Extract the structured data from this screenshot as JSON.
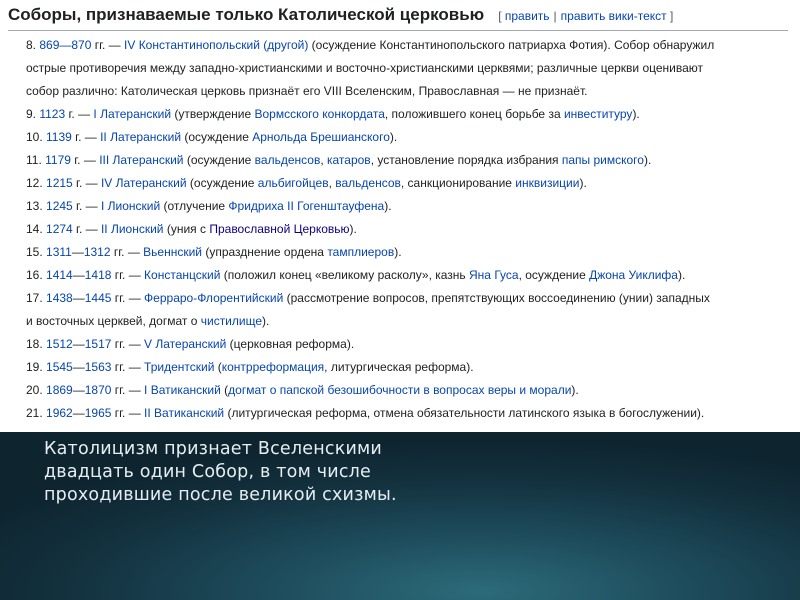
{
  "section": {
    "title": "Соборы, признаваемые только Католической церковью",
    "edit_open": "[",
    "edit_label": "править",
    "edit_sep": "|",
    "edit_source_label": "править вики-текст",
    "edit_close": "]"
  },
  "councils": [
    {
      "lines": [
        [
          {
            "t": "8. "
          },
          {
            "t": "869—870",
            "l": 1
          },
          {
            "t": " гг. — "
          },
          {
            "t": "IV Константинопольский (другой)",
            "l": 1
          },
          {
            "t": " (осуждение Константинопольского патриарха Фотия). Собор обнаружил"
          }
        ],
        [
          {
            "t": "острые противоречия между западно-христианскими и восточно-христианскими церквями; различные церкви оценивают"
          }
        ],
        [
          {
            "t": "собор различно: Католическая церковь признаёт его VIII Вселенским, Православная — не признаёт."
          }
        ]
      ]
    },
    {
      "lines": [
        [
          {
            "t": "9. "
          },
          {
            "t": "1123",
            "l": 1
          },
          {
            "t": " г. — "
          },
          {
            "t": "I Латеранский",
            "l": 1
          },
          {
            "t": " (утверждение "
          },
          {
            "t": "Вормсского конкордата",
            "l": 1
          },
          {
            "t": ", положившего конец борьбе за "
          },
          {
            "t": "инвеституру",
            "l": 1
          },
          {
            "t": ")."
          }
        ]
      ]
    },
    {
      "lines": [
        [
          {
            "t": "10. "
          },
          {
            "t": "1139",
            "l": 1
          },
          {
            "t": " г. — "
          },
          {
            "t": "II Латеранский",
            "l": 1
          },
          {
            "t": " (осуждение "
          },
          {
            "t": "Арнольда Брешианского",
            "l": 1
          },
          {
            "t": ")."
          }
        ]
      ]
    },
    {
      "lines": [
        [
          {
            "t": "11. "
          },
          {
            "t": "1179",
            "l": 1
          },
          {
            "t": " г. — "
          },
          {
            "t": "III Латеранский",
            "l": 1
          },
          {
            "t": " (осуждение "
          },
          {
            "t": "вальденсов",
            "l": 1
          },
          {
            "t": ", "
          },
          {
            "t": "катаров",
            "l": 1
          },
          {
            "t": ", установление порядка избрания "
          },
          {
            "t": "папы римского",
            "l": 1
          },
          {
            "t": ")."
          }
        ]
      ]
    },
    {
      "lines": [
        [
          {
            "t": "12. "
          },
          {
            "t": "1215",
            "l": 1
          },
          {
            "t": " г. — "
          },
          {
            "t": "IV Латеранский",
            "l": 1
          },
          {
            "t": " (осуждение "
          },
          {
            "t": "альбигойцев",
            "l": 1
          },
          {
            "t": ", "
          },
          {
            "t": "вальденсов",
            "l": 1
          },
          {
            "t": ", санкционирование "
          },
          {
            "t": "инквизиции",
            "l": 1
          },
          {
            "t": ")."
          }
        ]
      ]
    },
    {
      "lines": [
        [
          {
            "t": "13. "
          },
          {
            "t": "1245",
            "l": 1
          },
          {
            "t": " г. — "
          },
          {
            "t": "I Лионский",
            "l": 1
          },
          {
            "t": " (отлучение "
          },
          {
            "t": "Фридриха II Гогенштауфена",
            "l": 1
          },
          {
            "t": ")."
          }
        ]
      ]
    },
    {
      "lines": [
        [
          {
            "t": "14. "
          },
          {
            "t": "1274",
            "l": 1
          },
          {
            "t": " г. — "
          },
          {
            "t": "II Лионский",
            "l": 1
          },
          {
            "t": " (уния с "
          },
          {
            "t": "Православной Церковью",
            "l": 2
          },
          {
            "t": ")."
          }
        ]
      ]
    },
    {
      "lines": [
        [
          {
            "t": "15. "
          },
          {
            "t": "1311",
            "l": 1
          },
          {
            "t": "—"
          },
          {
            "t": "1312",
            "l": 1
          },
          {
            "t": " гг. — "
          },
          {
            "t": "Вьеннский",
            "l": 1
          },
          {
            "t": " (упразднение ордена "
          },
          {
            "t": "тамплиеров",
            "l": 1
          },
          {
            "t": ")."
          }
        ]
      ]
    },
    {
      "lines": [
        [
          {
            "t": "16. "
          },
          {
            "t": "1414",
            "l": 1
          },
          {
            "t": "—"
          },
          {
            "t": "1418",
            "l": 1
          },
          {
            "t": " гг. — "
          },
          {
            "t": "Констанцский",
            "l": 1
          },
          {
            "t": " (положил конец «великому расколу», казнь "
          },
          {
            "t": "Яна Гуса",
            "l": 1
          },
          {
            "t": ", осуждение "
          },
          {
            "t": "Джона Уиклифа",
            "l": 1
          },
          {
            "t": ")."
          }
        ]
      ]
    },
    {
      "lines": [
        [
          {
            "t": "17. "
          },
          {
            "t": "1438",
            "l": 1
          },
          {
            "t": "—"
          },
          {
            "t": "1445",
            "l": 1
          },
          {
            "t": " гг. — "
          },
          {
            "t": "Ферраро-Флорентийский",
            "l": 1
          },
          {
            "t": " (рассмотрение вопросов, препятствующих воссоединению (унии) западных"
          }
        ],
        [
          {
            "t": "и восточных церквей, догмат о "
          },
          {
            "t": "чистилище",
            "l": 1
          },
          {
            "t": ")."
          }
        ]
      ]
    },
    {
      "lines": [
        [
          {
            "t": "18. "
          },
          {
            "t": "1512",
            "l": 1
          },
          {
            "t": "—"
          },
          {
            "t": "1517",
            "l": 1
          },
          {
            "t": " гг. — "
          },
          {
            "t": "V Латеранский",
            "l": 1
          },
          {
            "t": " (церковная реформа)."
          }
        ]
      ]
    },
    {
      "lines": [
        [
          {
            "t": "19. "
          },
          {
            "t": "1545",
            "l": 1
          },
          {
            "t": "—"
          },
          {
            "t": "1563",
            "l": 1
          },
          {
            "t": " гг. — "
          },
          {
            "t": "Тридентский",
            "l": 1
          },
          {
            "t": " ("
          },
          {
            "t": "контрреформация",
            "l": 1
          },
          {
            "t": ", литургическая реформа)."
          }
        ]
      ]
    },
    {
      "lines": [
        [
          {
            "t": "20. "
          },
          {
            "t": "1869",
            "l": 1
          },
          {
            "t": "—"
          },
          {
            "t": "1870",
            "l": 1
          },
          {
            "t": " гг. — "
          },
          {
            "t": "I Ватиканский",
            "l": 1
          },
          {
            "t": " ("
          },
          {
            "t": "догмат о папской безошибочности в вопросах веры и морали",
            "l": 1
          },
          {
            "t": ")."
          }
        ]
      ]
    },
    {
      "lines": [
        [
          {
            "t": "21. "
          },
          {
            "t": "1962",
            "l": 1
          },
          {
            "t": "—"
          },
          {
            "t": "1965",
            "l": 1
          },
          {
            "t": " гг. — "
          },
          {
            "t": "II Ватиканский",
            "l": 1
          },
          {
            "t": " (литургическая реформа, отмена обязательности латинского языка в богослужении)."
          }
        ]
      ]
    }
  ],
  "caption": {
    "line1": "Католицизм признает Вселенскими",
    "line2": "двадцать один Собор, в том числе",
    "line3": "проходившие после великой схизмы."
  },
  "colors": {
    "link": "#0645ad",
    "visited_link": "#0b0080",
    "text": "#202122",
    "slide_bg": "#13303d",
    "caption_text": "#e6eef2"
  }
}
